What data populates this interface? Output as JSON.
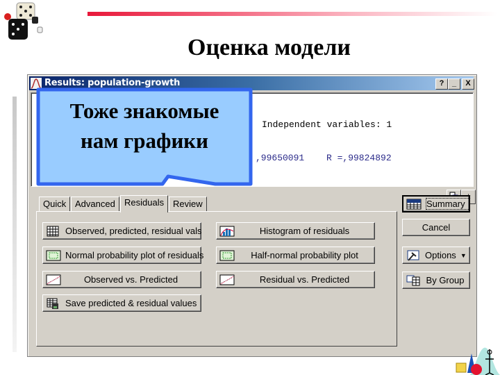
{
  "slide": {
    "title": "Оценка модели",
    "callout_text_line1": "Тоже знакомые",
    "callout_text_line2": "нам графики"
  },
  "window": {
    "title": "Results: population-growth",
    "caption_buttons": {
      "help": "?",
      "minimize": "_",
      "close": "X"
    },
    "output": {
      "independent_variables": "Independent variables: 1",
      "r2_fragment": ",99650091",
      "r_text": "R =,99824892"
    },
    "pane_buttons": {
      "copy": "⎘",
      "collapse": "±"
    }
  },
  "tabs": [
    {
      "label": "Quick",
      "active": false
    },
    {
      "label": "Advanced",
      "active": false
    },
    {
      "label": "Residuals",
      "active": true
    },
    {
      "label": "Review",
      "active": false
    }
  ],
  "residual_buttons": [
    {
      "label": "Observed, predicted, residual vals",
      "icon": "grid-icon"
    },
    {
      "label": "Histogram of residuals",
      "icon": "histogram-icon"
    },
    {
      "label": "Normal probability plot of residuals",
      "icon": "probability-plot-icon"
    },
    {
      "label": "Half-normal probability plot",
      "icon": "probability-plot-icon"
    },
    {
      "label": "Observed vs. Predicted",
      "icon": "scatterplot-icon"
    },
    {
      "label": "Residual vs. Predicted",
      "icon": "scatterplot-icon"
    },
    {
      "label": "Save predicted & residual values",
      "icon": "save-grid-icon"
    }
  ],
  "side_buttons": {
    "summary": "Summary",
    "cancel": "Cancel",
    "options": "Options",
    "by_group": "By Group"
  },
  "colors": {
    "callout_fill": "#99ccff",
    "callout_border": "#3366ee",
    "titlebar_start": "#0a246a",
    "dialog_bg": "#d4d0c8",
    "accent_line": "#e8183a"
  }
}
